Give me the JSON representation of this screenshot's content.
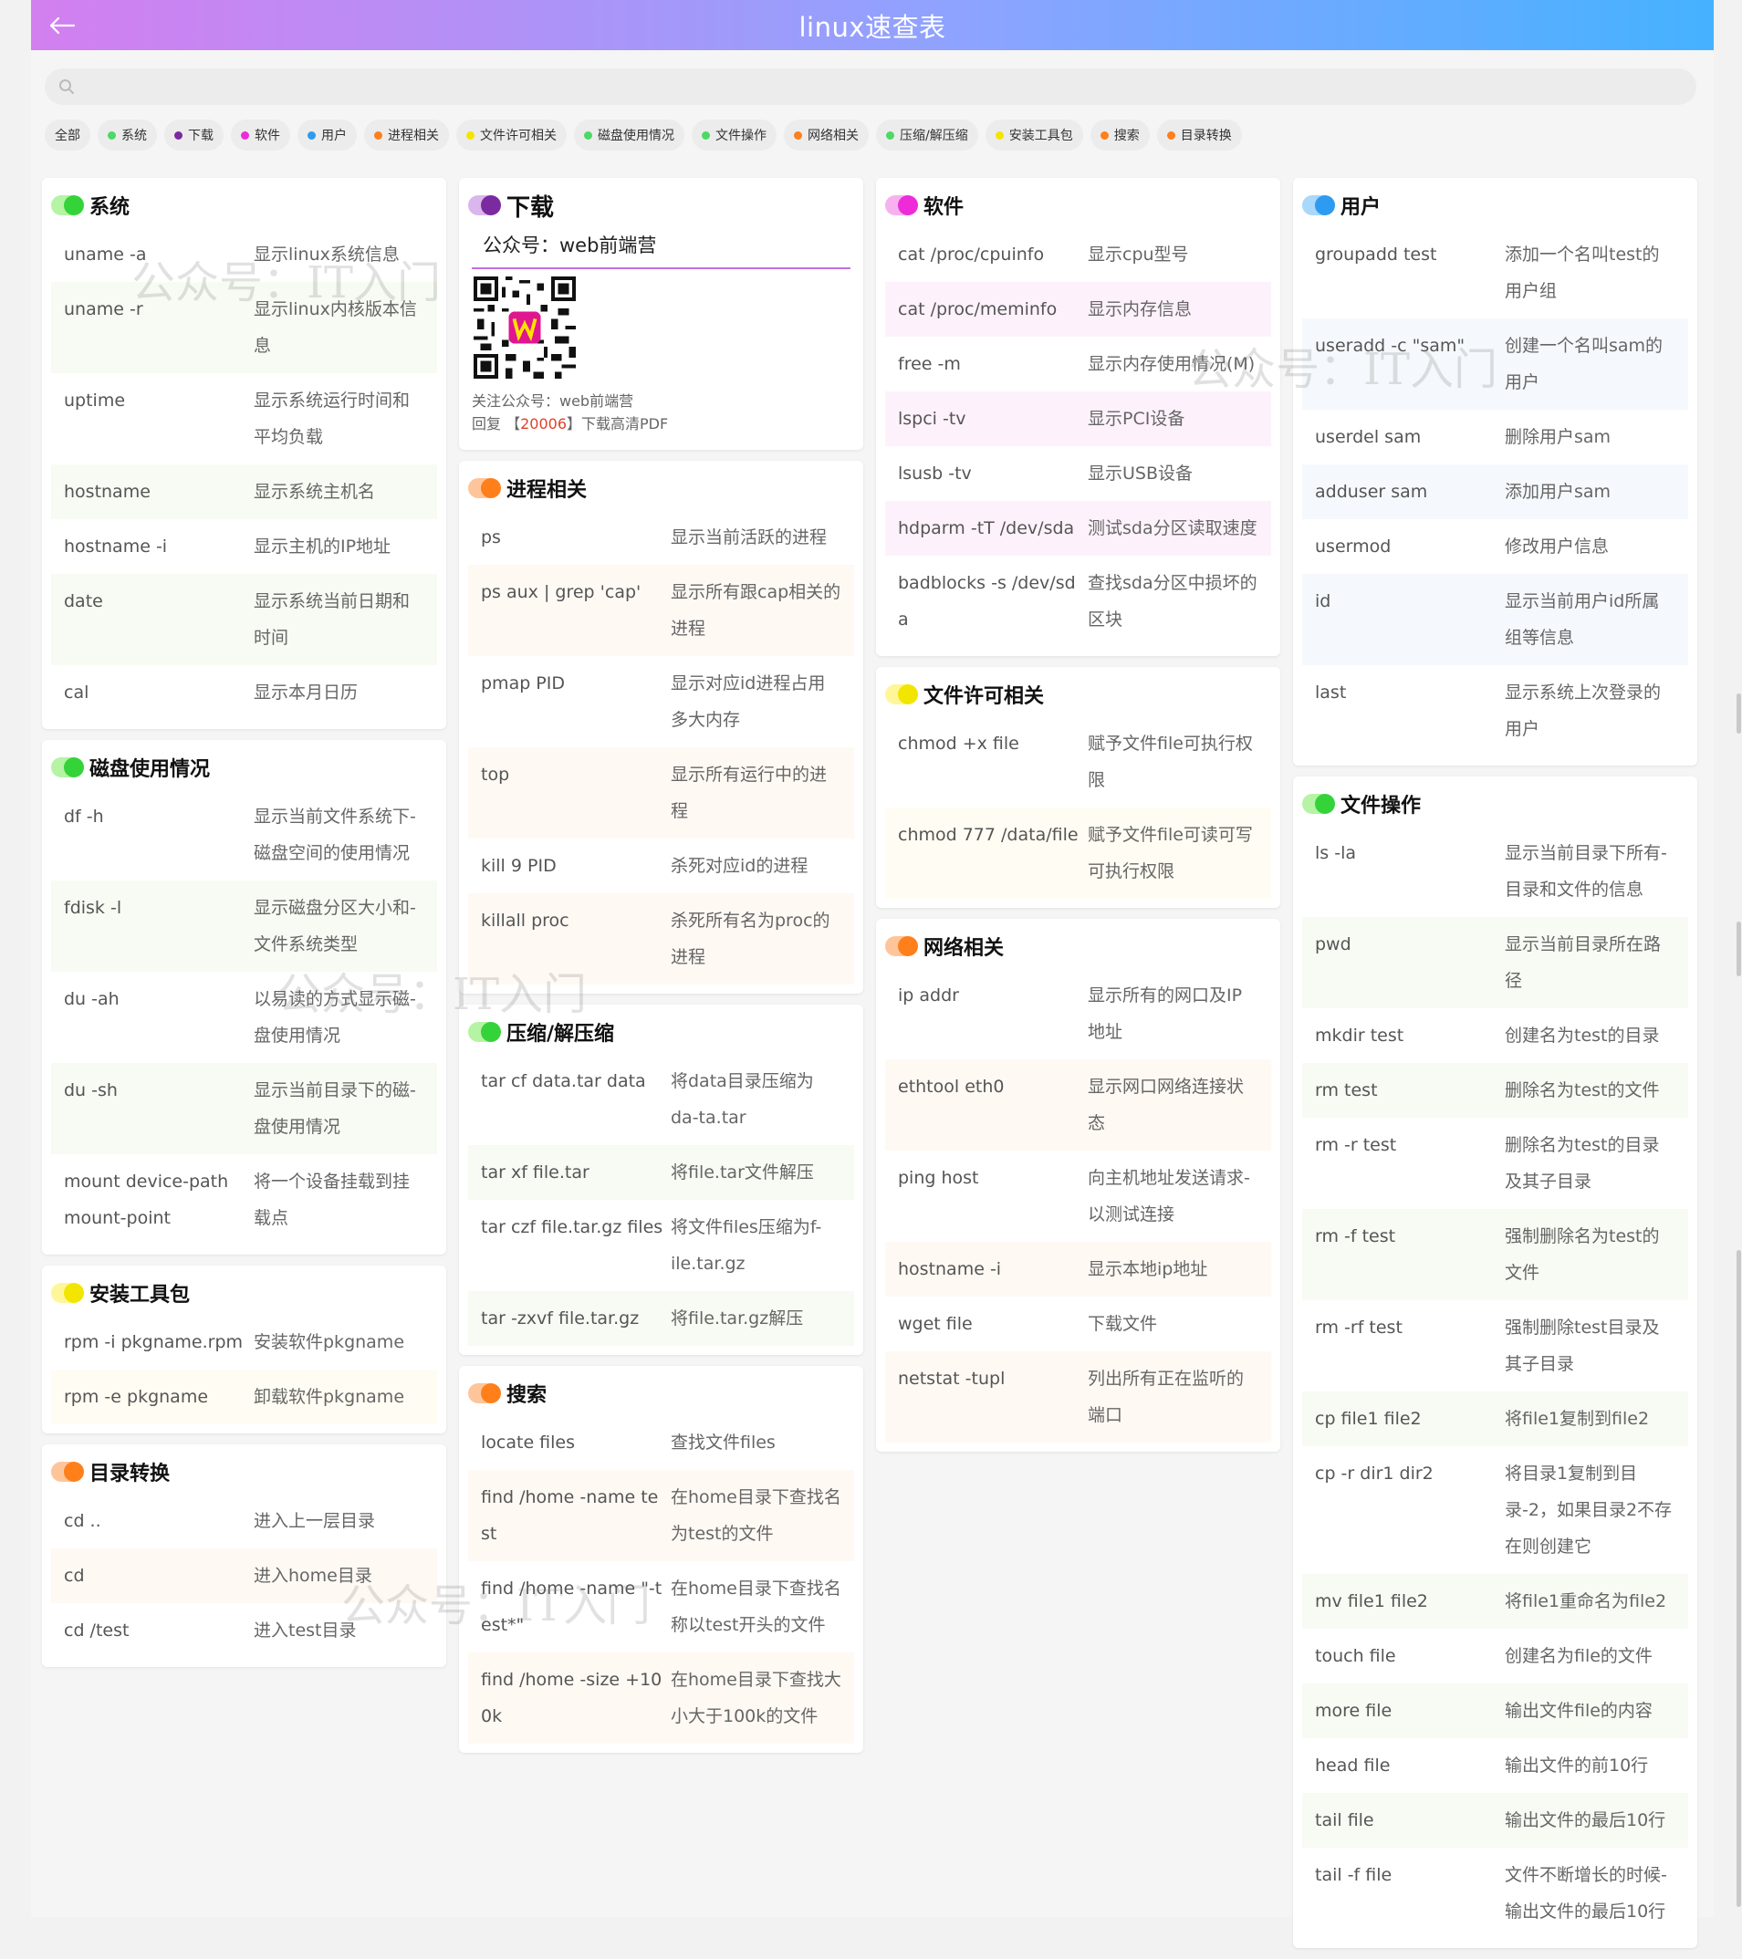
{
  "header": {
    "title": "linux速查表",
    "back_icon": "arrow-left-icon"
  },
  "search": {
    "placeholder": "",
    "value": "",
    "icon": "search-icon"
  },
  "filters": [
    {
      "label": "全部",
      "color": ""
    },
    {
      "label": "系统",
      "color": "#4cd964"
    },
    {
      "label": "下载",
      "color": "#7b2aa0"
    },
    {
      "label": "软件",
      "color": "#ee2bd9"
    },
    {
      "label": "用户",
      "color": "#2d9bf0"
    },
    {
      "label": "进程相关",
      "color": "#ff7f1a"
    },
    {
      "label": "文件许可相关",
      "color": "#f2e600"
    },
    {
      "label": "磁盘使用情况",
      "color": "#4cd964"
    },
    {
      "label": "文件操作",
      "color": "#4cd964"
    },
    {
      "label": "网络相关",
      "color": "#ff7f1a"
    },
    {
      "label": "压缩/解压缩",
      "color": "#4cd964"
    },
    {
      "label": "安装工具包",
      "color": "#f2e600"
    },
    {
      "label": "搜索",
      "color": "#ff7f1a"
    },
    {
      "label": "目录转换",
      "color": "#ff7f1a"
    }
  ],
  "colors": {
    "green": [
      "#b5f3a5",
      "#34d33a"
    ],
    "purple": [
      "#d9b6ec",
      "#7b2aa0"
    ],
    "magenta": [
      "#f7b1ef",
      "#ee2bd9"
    ],
    "blue": [
      "#a9d8fb",
      "#2d9bf0"
    ],
    "orange": [
      "#ffc59a",
      "#ff7f1a"
    ],
    "yellow": [
      "#fff69a",
      "#f2e600"
    ]
  },
  "promo": {
    "title": "下载",
    "heading": "公众号：web前端营",
    "line1": "关注公众号：web前端营",
    "line2_prefix": "回复 【",
    "line2_code": "20006",
    "line2_suffix": "】下载高清PDF"
  },
  "watermark": "公众号：IT入门",
  "sections": {
    "system": {
      "title": "系统",
      "rows": [
        {
          "cmd": "uname -a",
          "desc": "显示linux系统信息"
        },
        {
          "cmd": "uname -r",
          "desc": "显示linux内核版本信息"
        },
        {
          "cmd": "uptime",
          "desc": "显示系统运行时间和平均负载"
        },
        {
          "cmd": "hostname",
          "desc": "显示系统主机名"
        },
        {
          "cmd": "hostname -i",
          "desc": "显示主机的IP地址"
        },
        {
          "cmd": "date",
          "desc": "显示系统当前日期和时间"
        },
        {
          "cmd": "cal",
          "desc": "显示本月日历"
        }
      ]
    },
    "disk": {
      "title": "磁盘使用情况",
      "rows": [
        {
          "cmd": "df -h",
          "desc": "显示当前文件系统下-磁盘空间的使用情况"
        },
        {
          "cmd": "fdisk -l",
          "desc": "显示磁盘分区大小和-文件系统类型"
        },
        {
          "cmd": "du -ah",
          "desc": "以易读的方式显示磁-盘使用情况"
        },
        {
          "cmd": "du -sh",
          "desc": "显示当前目录下的磁-盘使用情况"
        },
        {
          "cmd": "mount device-path mount-point",
          "desc": "将一个设备挂载到挂载点"
        }
      ]
    },
    "install": {
      "title": "安装工具包",
      "rows": [
        {
          "cmd": "rpm -i pkgname.rpm",
          "desc": "安装软件pkgname"
        },
        {
          "cmd": "rpm -e pkgname",
          "desc": "卸载软件pkgname"
        }
      ]
    },
    "dirs": {
      "title": "目录转换",
      "rows": [
        {
          "cmd": "cd ..",
          "desc": "进入上一层目录"
        },
        {
          "cmd": "cd",
          "desc": "进入home目录"
        },
        {
          "cmd": "cd /test",
          "desc": "进入test目录"
        }
      ]
    },
    "process": {
      "title": "进程相关",
      "rows": [
        {
          "cmd": "ps",
          "desc": "显示当前活跃的进程"
        },
        {
          "cmd": "ps aux | grep 'cap'",
          "desc": "显示所有跟cap相关的进程"
        },
        {
          "cmd": "pmap PID",
          "desc": "显示对应id进程占用多大内存"
        },
        {
          "cmd": "top",
          "desc": "显示所有运行中的进程"
        },
        {
          "cmd": "kill 9 PID",
          "desc": "杀死对应id的进程"
        },
        {
          "cmd": "killall proc",
          "desc": "杀死所有名为proc的进程"
        }
      ]
    },
    "compress": {
      "title": "压缩/解压缩",
      "rows": [
        {
          "cmd": "tar cf data.tar data",
          "desc": "将data目录压缩为da-ta.tar"
        },
        {
          "cmd": "tar xf file.tar",
          "desc": "将file.tar文件解压"
        },
        {
          "cmd": "tar czf file.tar.gz files",
          "desc": "将文件files压缩为f-ile.tar.gz"
        },
        {
          "cmd": "tar -zxvf file.tar.gz",
          "desc": "将file.tar.gz解压"
        }
      ]
    },
    "search": {
      "title": "搜索",
      "rows": [
        {
          "cmd": "locate files",
          "desc": "查找文件files"
        },
        {
          "cmd": "find /home -name test",
          "desc": "在home目录下查找名为test的文件"
        },
        {
          "cmd": "find /home -name \"-test*\"",
          "desc": "在home目录下查找名称以test开头的文件"
        },
        {
          "cmd": "find /home -size +100k",
          "desc": "在home目录下查找大小大于100k的文件"
        }
      ]
    },
    "software": {
      "title": "软件",
      "rows": [
        {
          "cmd": "cat /proc/cpuinfo",
          "desc": "显示cpu型号"
        },
        {
          "cmd": "cat /proc/meminfo",
          "desc": "显示内存信息"
        },
        {
          "cmd": "free -m",
          "desc": "显示内存使用情况(M)"
        },
        {
          "cmd": "lspci -tv",
          "desc": "显示PCI设备"
        },
        {
          "cmd": "lsusb -tv",
          "desc": "显示USB设备"
        },
        {
          "cmd": "hdparm -tT /dev/sda",
          "desc": "测试sda分区读取速度"
        },
        {
          "cmd": "badblocks -s /dev/sda",
          "desc": "查找sda分区中损坏的区块"
        }
      ]
    },
    "perm": {
      "title": "文件许可相关",
      "rows": [
        {
          "cmd": "chmod +x file",
          "desc": "赋予文件file可执行权限"
        },
        {
          "cmd": "chmod 777 /data/file",
          "desc": "赋予文件file可读可写可执行权限"
        }
      ]
    },
    "network": {
      "title": "网络相关",
      "rows": [
        {
          "cmd": "ip addr",
          "desc": "显示所有的网口及IP地址"
        },
        {
          "cmd": "ethtool eth0",
          "desc": "显示网口网络连接状态"
        },
        {
          "cmd": "ping host",
          "desc": "向主机地址发送请求-以测试连接"
        },
        {
          "cmd": "hostname -i",
          "desc": "显示本地ip地址"
        },
        {
          "cmd": "wget file",
          "desc": "下载文件"
        },
        {
          "cmd": "netstat -tupl",
          "desc": "列出所有正在监听的端口"
        }
      ]
    },
    "user": {
      "title": "用户",
      "rows": [
        {
          "cmd": "groupadd test",
          "desc": "添加一个名叫test的用户组"
        },
        {
          "cmd": "useradd -c \"sam\"",
          "desc": "创建一个名叫sam的用户"
        },
        {
          "cmd": "userdel sam",
          "desc": "删除用户sam"
        },
        {
          "cmd": "adduser sam",
          "desc": "添加用户sam"
        },
        {
          "cmd": "usermod",
          "desc": "修改用户信息"
        },
        {
          "cmd": "id",
          "desc": "显示当前用户id所属组等信息"
        },
        {
          "cmd": "last",
          "desc": "显示系统上次登录的用户"
        }
      ]
    },
    "fileops": {
      "title": "文件操作",
      "rows": [
        {
          "cmd": "ls -la",
          "desc": "显示当前目录下所有-目录和文件的信息"
        },
        {
          "cmd": "pwd",
          "desc": "显示当前目录所在路径"
        },
        {
          "cmd": "mkdir test",
          "desc": "创建名为test的目录"
        },
        {
          "cmd": "rm test",
          "desc": "删除名为test的文件"
        },
        {
          "cmd": "rm -r test",
          "desc": "删除名为test的目录及其子目录"
        },
        {
          "cmd": "rm -f test",
          "desc": "强制删除名为test的文件"
        },
        {
          "cmd": "rm -rf test",
          "desc": "强制删除test目录及其子目录"
        },
        {
          "cmd": "cp file1 file2",
          "desc": "将file1复制到file2"
        },
        {
          "cmd": "cp -r dir1 dir2",
          "desc": "将目录1复制到目录-2，如果目录2不存在则创建它"
        },
        {
          "cmd": "mv file1 file2",
          "desc": "将file1重命名为file2"
        },
        {
          "cmd": "touch file",
          "desc": "创建名为file的文件"
        },
        {
          "cmd": "more file",
          "desc": "输出文件file的内容"
        },
        {
          "cmd": "head file",
          "desc": "输出文件的前10行"
        },
        {
          "cmd": "tail file",
          "desc": "输出文件的最后10行"
        },
        {
          "cmd": "tail -f file",
          "desc": "文件不断增长的时候-输出文件的最后10行"
        }
      ]
    }
  }
}
